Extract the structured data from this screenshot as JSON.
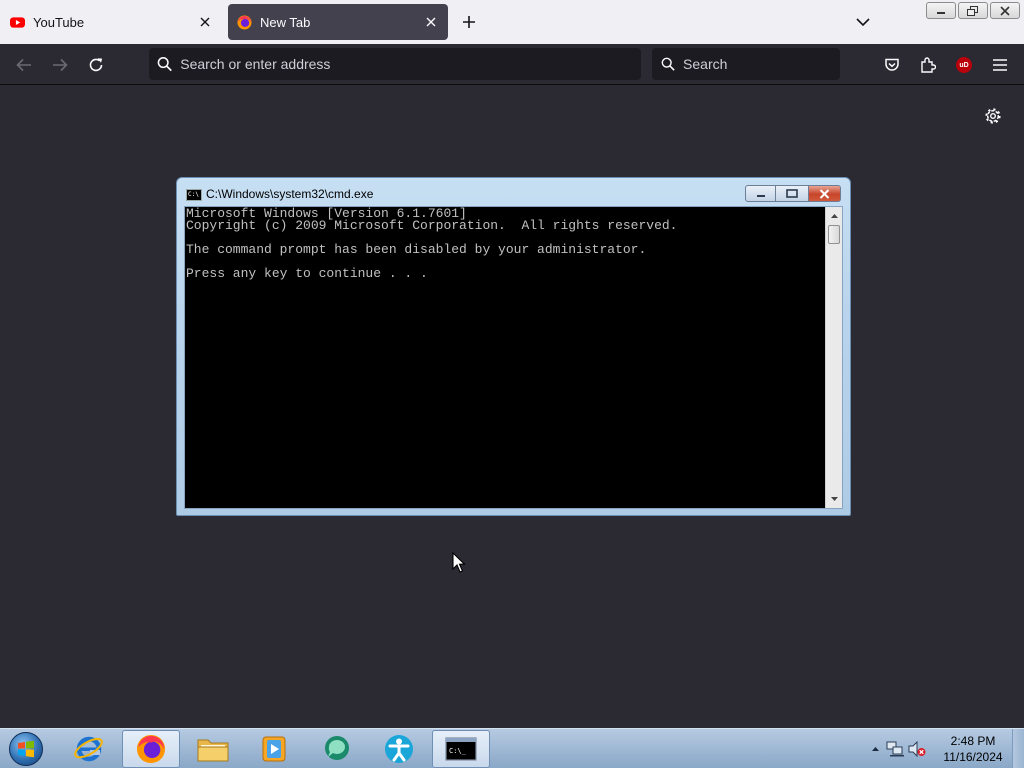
{
  "browser": {
    "tabs": [
      {
        "label": "YouTube",
        "icon": "youtube-icon"
      },
      {
        "label": "New Tab",
        "icon": "firefox-icon",
        "active": true
      }
    ],
    "address": {
      "placeholder": "Search or enter address",
      "value": ""
    },
    "search": {
      "placeholder": "Search",
      "value": ""
    },
    "toolbar_icons": [
      "pocket-icon",
      "extensions-icon",
      "ublock-origin-icon",
      "menu-icon"
    ],
    "ublock_label": "uD",
    "colors": {
      "chrome_light": "#f0f0f4",
      "page_bg": "#2b2a33",
      "active_tab": "#42414d",
      "field": "#1c1b22"
    }
  },
  "cmd": {
    "title": "C:\\Windows\\system32\\cmd.exe",
    "icon_text": "C:\\",
    "lines": [
      "Microsoft Windows [Version 6.1.7601]",
      "Copyright (c) 2009 Microsoft Corporation.  All rights reserved.",
      "",
      "The command prompt has been disabled by your administrator.",
      "",
      "Press any key to continue . . ."
    ]
  },
  "taskbar": {
    "items": [
      "start-orb",
      "internet-explorer-icon",
      "firefox-icon",
      "file-explorer-icon",
      "media-player-icon",
      "chat-app-icon",
      "accessibility-app-icon",
      "command-prompt-icon"
    ],
    "cmd_icon_text": "C:\\_",
    "clock": {
      "time": "2:48 PM",
      "date": "11/16/2024"
    }
  }
}
